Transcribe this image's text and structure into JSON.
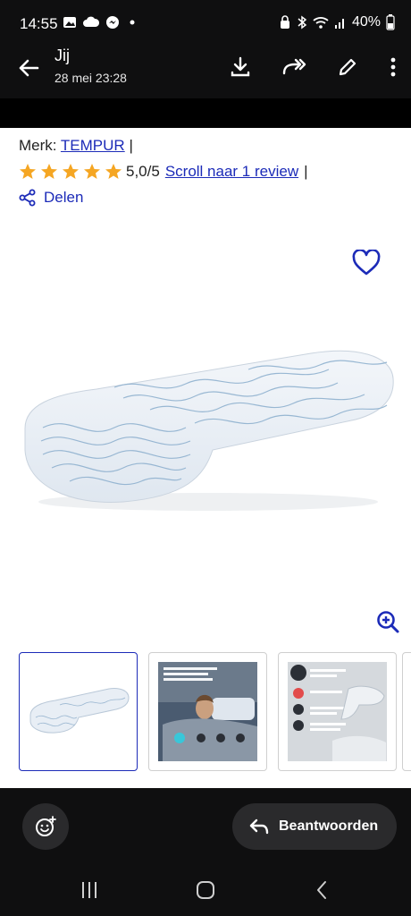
{
  "status": {
    "time": "14:55",
    "battery": "40%",
    "left_icons": [
      "gallery-icon",
      "cloud-icon",
      "messenger-icon",
      "dot-icon"
    ],
    "right_icons": [
      "lock-icon",
      "bluetooth-icon",
      "wifi-icon",
      "signal-icon",
      "battery-icon"
    ]
  },
  "header": {
    "sender": "Jij",
    "date": "28 mei 23:28"
  },
  "product": {
    "brand_label": "Merk:",
    "brand_name": "TEMPUR",
    "separator": "|",
    "rating": "5,0/5",
    "rating_value": 5,
    "rating_max": 5,
    "review_link": "Scroll naar 1 review",
    "share_label": "Delen"
  },
  "thumbnails": [
    {
      "name": "pillow-main"
    },
    {
      "name": "pillow-woman-sleeping"
    },
    {
      "name": "pillow-features"
    }
  ],
  "bottom": {
    "reply_label": "Beantwoorden"
  },
  "colors": {
    "link": "#1c2bb8",
    "star": "#f5a623",
    "dark": "#0f0f10"
  }
}
